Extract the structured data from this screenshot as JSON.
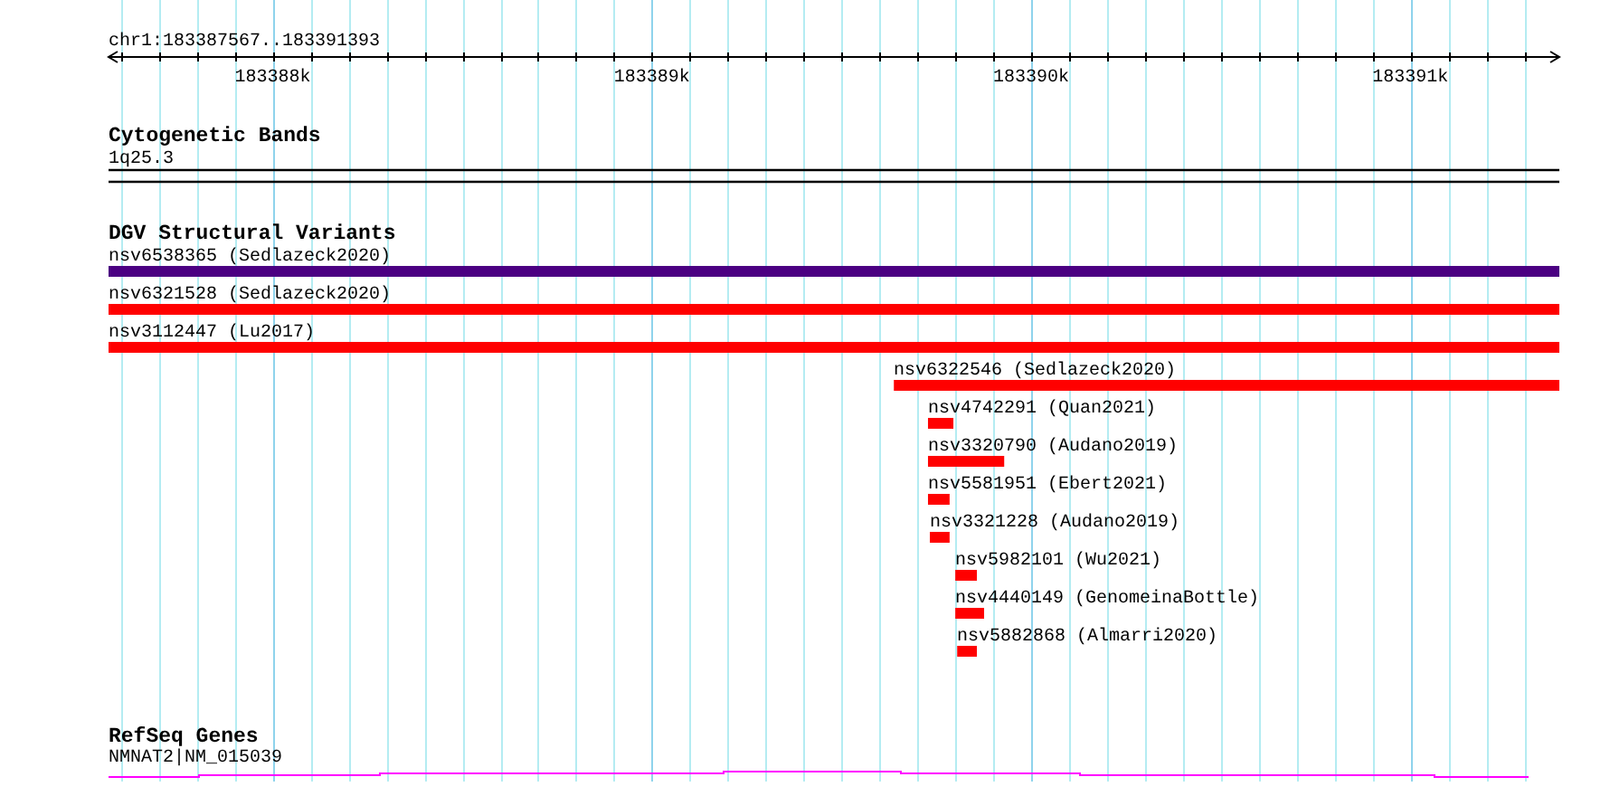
{
  "location": "chr1:183387567..183391393",
  "ruler": {
    "ticks": [
      "183388k",
      "183389k",
      "183390k",
      "183391k"
    ]
  },
  "tracks": [
    {
      "kind": "cytoband",
      "title": "Cytogenetic Bands",
      "band": "1q25.3"
    },
    {
      "kind": "variants",
      "title": "DGV Structural Variants",
      "features": [
        {
          "label": "nsv6538365 (Sedlazeck2020)",
          "color": "#4b0082"
        },
        {
          "label": "nsv6321528 (Sedlazeck2020)",
          "color": "#ff0000"
        },
        {
          "label": "nsv3112447 (Lu2017)",
          "color": "#ff0000"
        },
        {
          "label": "nsv6322546 (Sedlazeck2020)",
          "color": "#ff0000"
        },
        {
          "label": "nsv4742291 (Quan2021)",
          "color": "#ff0000"
        },
        {
          "label": "nsv3320790 (Audano2019)",
          "color": "#ff0000"
        },
        {
          "label": "nsv5581951 (Ebert2021)",
          "color": "#ff0000"
        },
        {
          "label": "nsv3321228 (Audano2019)",
          "color": "#ff0000"
        },
        {
          "label": "nsv5982101 (Wu2021)",
          "color": "#ff0000"
        },
        {
          "label": "nsv4440149 (GenomeinaBottle)",
          "color": "#ff0000"
        },
        {
          "label": "nsv5882868 (Almarri2020)",
          "color": "#ff0000"
        }
      ]
    },
    {
      "kind": "genes",
      "title": "RefSeq Genes",
      "gene": "NMNAT2|NM_015039"
    }
  ]
}
